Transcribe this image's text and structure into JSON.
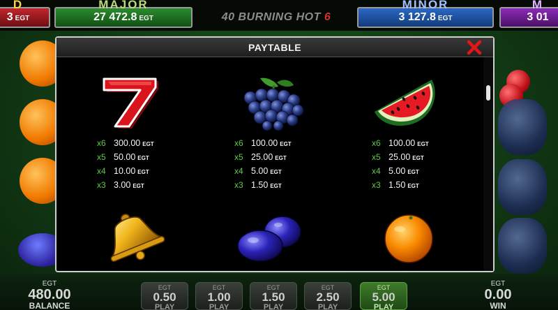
{
  "jackpots": [
    {
      "id": "ltd",
      "name": "D",
      "value": "3",
      "currency": "EGT"
    },
    {
      "id": "major",
      "name": "MAJOR",
      "value": "27 472.8",
      "currency": "EGT"
    },
    {
      "id": "minor",
      "name": "MINOR",
      "value": "3 127.8",
      "currency": "EGT"
    },
    {
      "id": "mini",
      "name": "M",
      "value": "3 01",
      "currency": ""
    }
  ],
  "game_title": {
    "text": "40 BURNING HOT",
    "six": "6"
  },
  "dialog": {
    "title": "PAYTABLE",
    "close_icon": "close-x-icon",
    "accent_color": "#e0161b",
    "multiplier_color": "#5fc84a"
  },
  "paytable": [
    {
      "symbol": "seven-icon",
      "payouts": [
        {
          "mult": "x6",
          "amount": "300.00",
          "unit": "EGT"
        },
        {
          "mult": "x5",
          "amount": "50.00",
          "unit": "EGT"
        },
        {
          "mult": "x4",
          "amount": "10.00",
          "unit": "EGT"
        },
        {
          "mult": "x3",
          "amount": "3.00",
          "unit": "EGT"
        }
      ]
    },
    {
      "symbol": "grapes-icon",
      "payouts": [
        {
          "mult": "x6",
          "amount": "100.00",
          "unit": "EGT"
        },
        {
          "mult": "x5",
          "amount": "25.00",
          "unit": "EGT"
        },
        {
          "mult": "x4",
          "amount": "5.00",
          "unit": "EGT"
        },
        {
          "mult": "x3",
          "amount": "1.50",
          "unit": "EGT"
        }
      ]
    },
    {
      "symbol": "watermelon-icon",
      "payouts": [
        {
          "mult": "x6",
          "amount": "100.00",
          "unit": "EGT"
        },
        {
          "mult": "x5",
          "amount": "25.00",
          "unit": "EGT"
        },
        {
          "mult": "x4",
          "amount": "5.00",
          "unit": "EGT"
        },
        {
          "mult": "x3",
          "amount": "1.50",
          "unit": "EGT"
        }
      ]
    },
    {
      "symbol": "bell-icon",
      "payouts": []
    },
    {
      "symbol": "plum-icon",
      "payouts": []
    },
    {
      "symbol": "orange-icon",
      "payouts": []
    }
  ],
  "balance": {
    "currency": "EGT",
    "value": "480.00",
    "label": "BALANCE"
  },
  "win": {
    "currency": "EGT",
    "value": "0.00",
    "label": "WIN"
  },
  "bet_buttons": [
    {
      "currency": "EGT",
      "value": "0.50",
      "label": "PLAY",
      "active": false
    },
    {
      "currency": "EGT",
      "value": "1.00",
      "label": "PLAY",
      "active": false
    },
    {
      "currency": "EGT",
      "value": "1.50",
      "label": "PLAY",
      "active": false
    },
    {
      "currency": "EGT",
      "value": "2.50",
      "label": "PLAY",
      "active": false
    },
    {
      "currency": "EGT",
      "value": "5.00",
      "label": "PLAY",
      "active": true
    }
  ]
}
